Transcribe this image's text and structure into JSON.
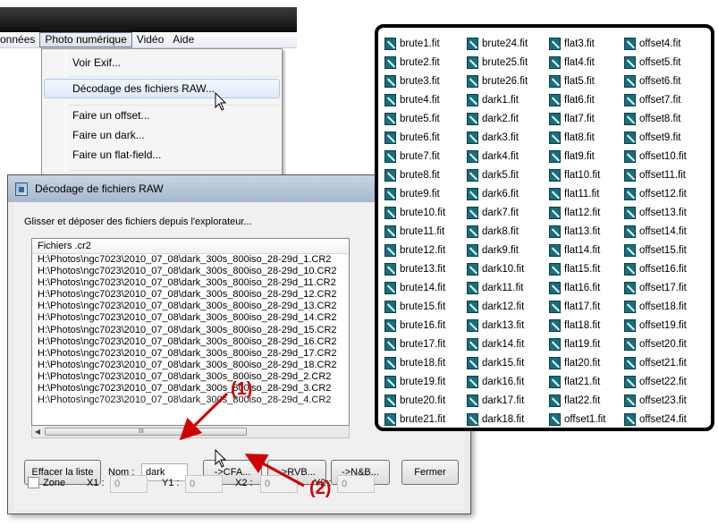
{
  "menubar": {
    "items": [
      "onnées",
      "Photo numérique",
      "Vidéo",
      "Aide"
    ]
  },
  "dropdown": {
    "items": [
      "Voir Exif...",
      "Décodage des fichiers RAW...",
      "Faire un offset...",
      "Faire un dark...",
      "Faire un flat-field..."
    ],
    "highlighted": "Décodage des fichiers RAW..."
  },
  "dialog": {
    "title": "Décodage de fichiers RAW",
    "hint": "Glisser et déposer des fichiers depuis l'explorateur...",
    "list_header": "Fichiers .cr2",
    "files": [
      "H:\\Photos\\ngc7023\\2010_07_08\\dark_300s_800iso_28-29d_1.CR2",
      "H:\\Photos\\ngc7023\\2010_07_08\\dark_300s_800iso_28-29d_10.CR2",
      "H:\\Photos\\ngc7023\\2010_07_08\\dark_300s_800iso_28-29d_11.CR2",
      "H:\\Photos\\ngc7023\\2010_07_08\\dark_300s_800iso_28-29d_12.CR2",
      "H:\\Photos\\ngc7023\\2010_07_08\\dark_300s_800iso_28-29d_13.CR2",
      "H:\\Photos\\ngc7023\\2010_07_08\\dark_300s_800iso_28-29d_14.CR2",
      "H:\\Photos\\ngc7023\\2010_07_08\\dark_300s_800iso_28-29d_15.CR2",
      "H:\\Photos\\ngc7023\\2010_07_08\\dark_300s_800iso_28-29d_16.CR2",
      "H:\\Photos\\ngc7023\\2010_07_08\\dark_300s_800iso_28-29d_17.CR2",
      "H:\\Photos\\ngc7023\\2010_07_08\\dark_300s_800iso_28-29d_18.CR2",
      "H:\\Photos\\ngc7023\\2010_07_08\\dark_300s_800iso_28-29d_2.CR2",
      "H:\\Photos\\ngc7023\\2010_07_08\\dark_300s_800iso_28-29d_3.CR2",
      "H:\\Photos\\ngc7023\\2010_07_08\\dark_300s_800iso_28-29d_4.CR2"
    ],
    "buttons": {
      "clear": "Effacer la liste",
      "cfa": "->CFA...",
      "rvb": "->RVB...",
      "nb": "->N&B...",
      "close": "Fermer"
    },
    "name_label": "Nom :",
    "name_value": "dark",
    "zone_label": "Zone",
    "x1_label": "X1 :",
    "y1_label": "Y1 :",
    "x2_label": "X2 :",
    "y2_label": "Y2 :",
    "x1_value": "0",
    "y1_value": "0",
    "x2_value": "0",
    "y2_value": "0",
    "scroll_grip": "III"
  },
  "annotations": {
    "step1": "(1)",
    "step2": "(2)",
    "color": "#d00000"
  },
  "files_panel": {
    "files": [
      "brute1.fit",
      "brute2.fit",
      "brute3.fit",
      "brute4.fit",
      "brute5.fit",
      "brute6.fit",
      "brute7.fit",
      "brute8.fit",
      "brute9.fit",
      "brute10.fit",
      "brute11.fit",
      "brute12.fit",
      "brute13.fit",
      "brute14.fit",
      "brute15.fit",
      "brute16.fit",
      "brute17.fit",
      "brute18.fit",
      "brute19.fit",
      "brute20.fit",
      "brute21.fit",
      "brute24.fit",
      "brute25.fit",
      "brute26.fit",
      "dark1.fit",
      "dark2.fit",
      "dark3.fit",
      "dark4.fit",
      "dark5.fit",
      "dark6.fit",
      "dark7.fit",
      "dark8.fit",
      "dark9.fit",
      "dark10.fit",
      "dark11.fit",
      "dark12.fit",
      "dark13.fit",
      "dark14.fit",
      "dark15.fit",
      "dark16.fit",
      "dark17.fit",
      "dark18.fit",
      "flat3.fit",
      "flat4.fit",
      "flat5.fit",
      "flat6.fit",
      "flat7.fit",
      "flat8.fit",
      "flat9.fit",
      "flat10.fit",
      "flat11.fit",
      "flat12.fit",
      "flat13.fit",
      "flat14.fit",
      "flat15.fit",
      "flat16.fit",
      "flat17.fit",
      "flat18.fit",
      "flat19.fit",
      "flat20.fit",
      "flat21.fit",
      "flat22.fit",
      "offset1.fit",
      "offset4.fit",
      "offset5.fit",
      "offset6.fit",
      "offset7.fit",
      "offset8.fit",
      "offset9.fit",
      "offset10.fit",
      "offset11.fit",
      "offset12.fit",
      "offset13.fit",
      "offset14.fit",
      "offset15.fit",
      "offset16.fit",
      "offset17.fit",
      "offset18.fit",
      "offset19.fit",
      "offset20.fit",
      "offset21.fit",
      "offset22.fit",
      "offset23.fit",
      "offset24.fit"
    ],
    "file_icon": "fits-file-icon"
  }
}
